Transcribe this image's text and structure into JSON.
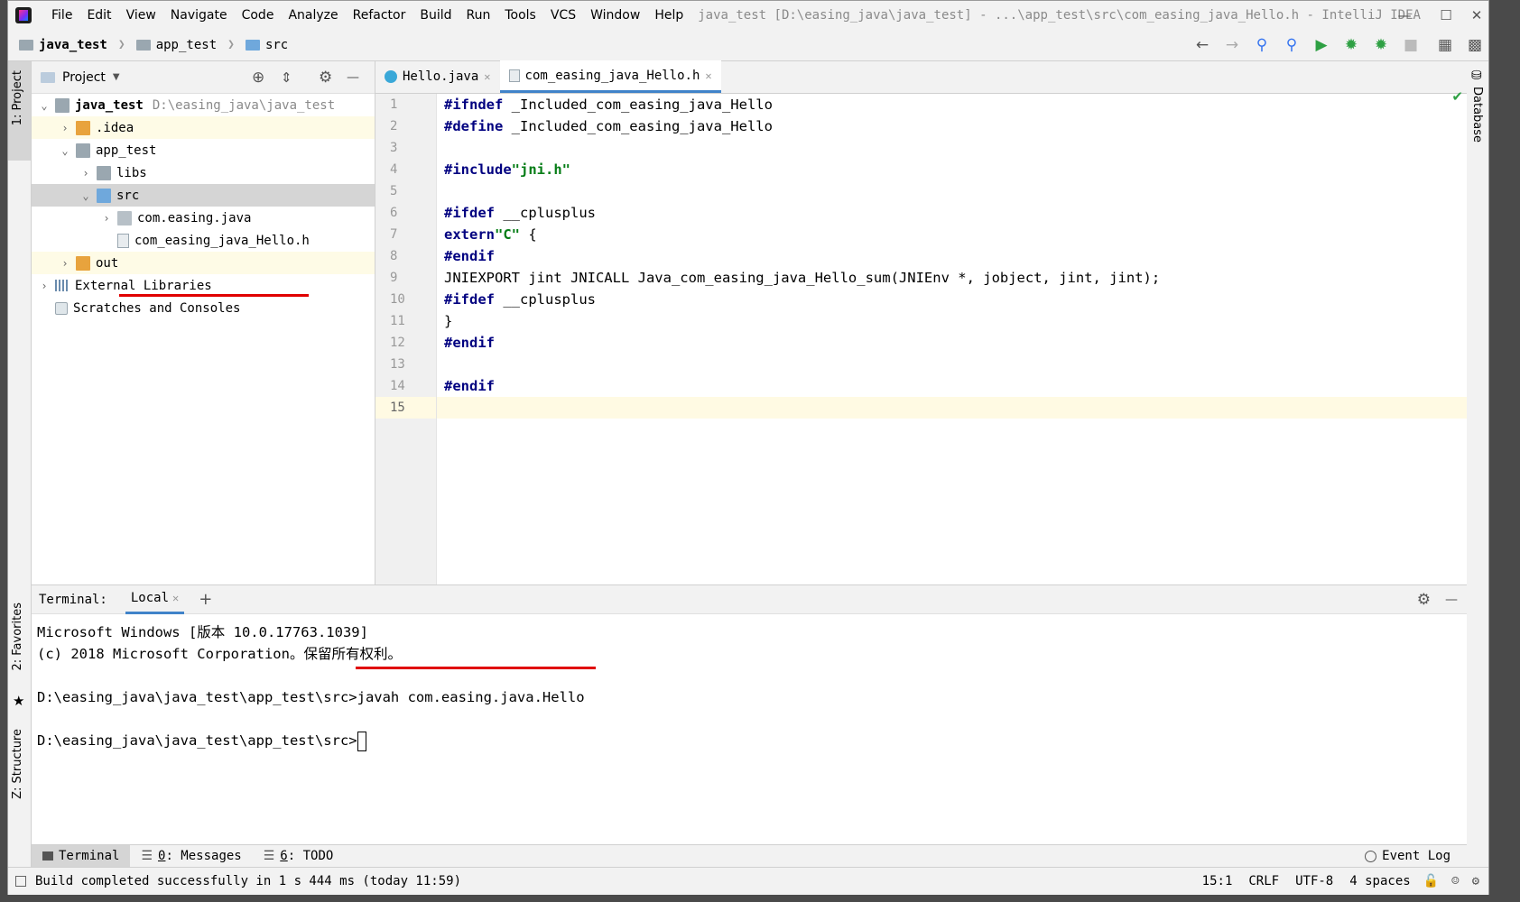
{
  "menu": {
    "items": [
      "File",
      "Edit",
      "View",
      "Navigate",
      "Code",
      "Analyze",
      "Refactor",
      "Build",
      "Run",
      "Tools",
      "VCS",
      "Window",
      "Help"
    ],
    "window_title": "java_test [D:\\easing_java\\java_test] - ...\\app_test\\src\\com_easing_java_Hello.h - IntelliJ IDEA"
  },
  "breadcrumb": {
    "items": [
      "java_test",
      "app_test",
      "src"
    ]
  },
  "left_strip": {
    "project": "1: Project",
    "favorites": "2: Favorites",
    "structure": "Z: Structure"
  },
  "right_strip": {
    "database": "Database"
  },
  "project": {
    "header": "Project",
    "tree": [
      {
        "label": "java_test",
        "path": "D:\\easing_java\\java_test"
      },
      {
        "label": ".idea"
      },
      {
        "label": "app_test"
      },
      {
        "label": "libs"
      },
      {
        "label": "src"
      },
      {
        "label": "com.easing.java"
      },
      {
        "label": "com_easing_java_Hello.h"
      },
      {
        "label": "out"
      },
      {
        "label": "External Libraries"
      },
      {
        "label": "Scratches and Consoles"
      }
    ]
  },
  "editor": {
    "tabs": [
      {
        "label": "Hello.java"
      },
      {
        "label": "com_easing_java_Hello.h"
      }
    ],
    "line_numbers": [
      "1",
      "2",
      "3",
      "4",
      "5",
      "6",
      "7",
      "8",
      "9",
      "10",
      "11",
      "12",
      "13",
      "14",
      "15"
    ],
    "lines": {
      "l1_kw": "#ifndef",
      "l1_rest": " _Included_com_easing_java_Hello",
      "l2_kw": "#define",
      "l2_rest": " _Included_com_easing_java_Hello",
      "l4_kw": "#include",
      "l4_str": "\"jni.h\"",
      "l6_kw": "#ifdef",
      "l6_rest": " __cplusplus",
      "l7_kw": "extern",
      "l7_str": "\"C\"",
      "l7_rest": " {",
      "l8_kw": "#endif",
      "l9_rest": "JNIEXPORT jint JNICALL Java_com_easing_java_Hello_sum(JNIEnv *, jobject, jint, jint);",
      "l10_kw": "#ifdef",
      "l10_rest": " __cplusplus",
      "l11_rest": "}",
      "l12_kw": "#endif",
      "l14_kw": "#endif"
    }
  },
  "terminal": {
    "label": "Terminal:",
    "tab": "Local",
    "lines": [
      "Microsoft Windows [版本 10.0.17763.1039]",
      "(c) 2018 Microsoft Corporation。保留所有权利。",
      "",
      "D:\\easing_java\\java_test\\app_test\\src>javah com.easing.java.Hello",
      "",
      "D:\\easing_java\\java_test\\app_test\\src>"
    ]
  },
  "bottom_tabs": {
    "terminal": "Terminal",
    "messages_num": "0",
    "messages": ": Messages",
    "todo_num": "6",
    "todo": ": TODO",
    "event_log": "Event Log"
  },
  "status": {
    "message": "Build completed successfully in 1 s 444 ms (today 11:59)",
    "position": "15:1",
    "line_sep": "CRLF",
    "encoding": "UTF-8",
    "indent": "4 spaces"
  }
}
